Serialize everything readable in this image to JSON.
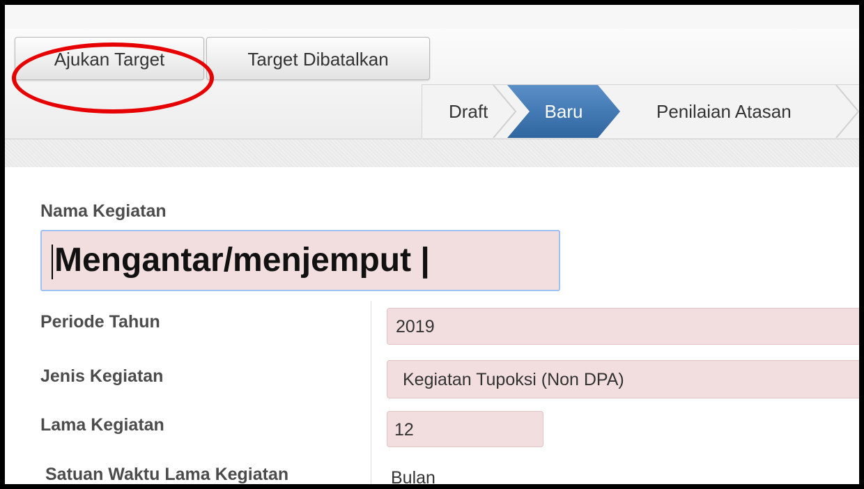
{
  "toolbar": {
    "submit_label": "Ajukan Target",
    "cancel_label": "Target Dibatalkan"
  },
  "statusbar": {
    "steps": [
      "Draft",
      "Baru",
      "Penilaian Atasan"
    ],
    "active_step": "Baru"
  },
  "form": {
    "nama_kegiatan": {
      "label": "Nama Kegiatan",
      "value": "Mengantar/menjemput |"
    },
    "periode_tahun": {
      "label": "Periode Tahun",
      "value": "2019"
    },
    "jenis_kegiatan": {
      "label": "Jenis Kegiatan",
      "value": "Kegiatan Tupoksi (Non DPA)"
    },
    "lama_kegiatan": {
      "label": "Lama Kegiatan",
      "value": "12"
    },
    "satuan_waktu": {
      "label": "Satuan Waktu Lama Kegiatan",
      "value": "Bulan"
    }
  },
  "colors": {
    "highlight_ring": "#e60000",
    "active_step": "#3a74b0",
    "required_field_bg": "#f2dede"
  }
}
